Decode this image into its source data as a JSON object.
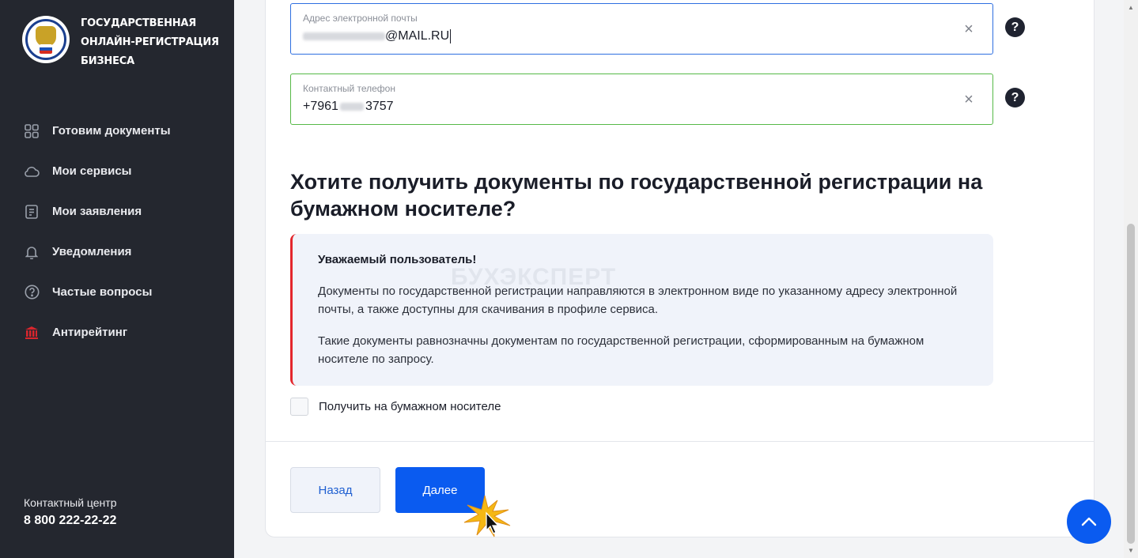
{
  "sidebar": {
    "logo": {
      "line1": "ГОСУДАРСТВЕННАЯ",
      "line2": "ОНЛАЙН-РЕГИСТРАЦИЯ",
      "line3": "БИЗНЕСА"
    },
    "items": [
      {
        "label": "Готовим документы",
        "icon": "grid-icon"
      },
      {
        "label": "Мои сервисы",
        "icon": "cloud-icon"
      },
      {
        "label": "Мои заявления",
        "icon": "document-icon"
      },
      {
        "label": "Уведомления",
        "icon": "bell-icon"
      },
      {
        "label": "Частые вопросы",
        "icon": "question-circle-icon"
      },
      {
        "label": "Антирейтинг",
        "icon": "building-icon"
      }
    ],
    "contact": {
      "title": "Контактный центр",
      "phone": "8 800 222-22-22"
    }
  },
  "form": {
    "email": {
      "label": "Адрес электронной почты",
      "value_visible": "@MAIL.RU"
    },
    "phone": {
      "label": "Контактный телефон",
      "value_prefix": "+7961",
      "value_suffix": "3757"
    },
    "help_glyph": "?",
    "clear_glyph": "×"
  },
  "section": {
    "heading": "Хотите получить документы по государственной регистрации на бумажном носителе?"
  },
  "notice": {
    "title": "Уважаемый пользователь!",
    "paragraph1": "Документы по государственной регистрации направляются в электронном виде по указанному адресу электронной почты, а также доступны для скачивания в профиле сервиса.",
    "paragraph2": "Такие документы равнозначны документам по государственной регистрации, сформированным на бумажном носителе по запросу.",
    "accent_color": "#e3272d",
    "watermark": "БУХЭКСПЕРТ"
  },
  "checkbox": {
    "label": "Получить на бумажном носителе",
    "checked": false
  },
  "buttons": {
    "back": "Назад",
    "next": "Далее",
    "primary_color": "#0a5bf0"
  }
}
